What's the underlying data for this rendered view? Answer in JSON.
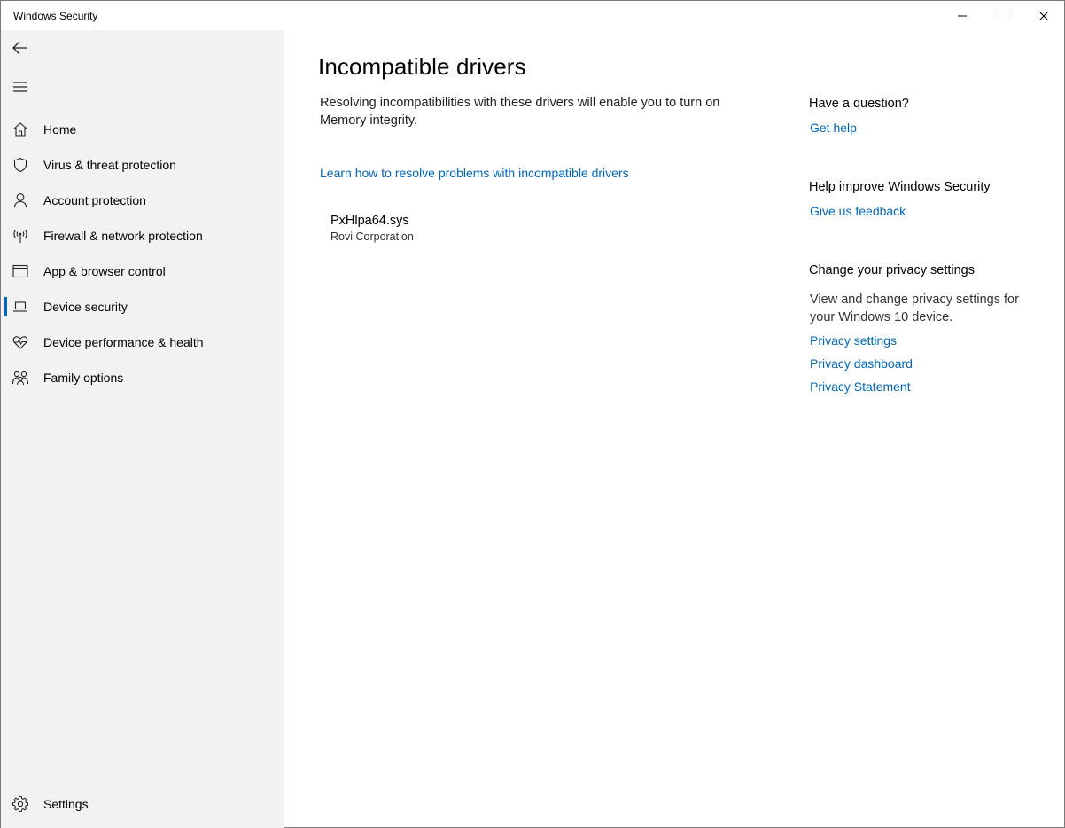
{
  "window": {
    "title": "Windows Security",
    "controls": [
      "minimize-icon",
      "maximize-icon",
      "close-icon"
    ]
  },
  "sidebar": {
    "back_icon": "back-arrow-icon",
    "menu_icon": "hamburger-menu-icon",
    "items": [
      {
        "label": "Home",
        "icon": "home-icon"
      },
      {
        "label": "Virus & threat protection",
        "icon": "shield-icon"
      },
      {
        "label": "Account protection",
        "icon": "person-icon"
      },
      {
        "label": "Firewall & network protection",
        "icon": "antenna-icon"
      },
      {
        "label": "App & browser control",
        "icon": "browser-window-icon"
      },
      {
        "label": "Device security",
        "icon": "laptop-icon",
        "selected": true
      },
      {
        "label": "Device performance & health",
        "icon": "heart-pulse-icon"
      },
      {
        "label": "Family options",
        "icon": "family-icon"
      }
    ],
    "settings": {
      "label": "Settings",
      "icon": "gear-icon"
    }
  },
  "main": {
    "title": "Incompatible drivers",
    "description": "Resolving incompatibilities with these drivers will enable you to turn on Memory integrity.",
    "learn_link": "Learn how to resolve problems with incompatible drivers",
    "drivers": [
      {
        "name": "PxHlpa64.sys",
        "vendor": "Rovi Corporation"
      }
    ]
  },
  "aside": {
    "question_heading": "Have a question?",
    "get_help": "Get help",
    "improve_heading": "Help improve Windows Security",
    "feedback": "Give us feedback",
    "privacy_heading": "Change your privacy settings",
    "privacy_text": "View and change privacy settings for your Windows 10 device.",
    "privacy_settings": "Privacy settings",
    "privacy_dashboard": "Privacy dashboard",
    "privacy_statement": "Privacy Statement"
  },
  "colors": {
    "accent": "#0067c0",
    "link": "#0067b8",
    "sidebar_bg": "#f2f2f2"
  }
}
